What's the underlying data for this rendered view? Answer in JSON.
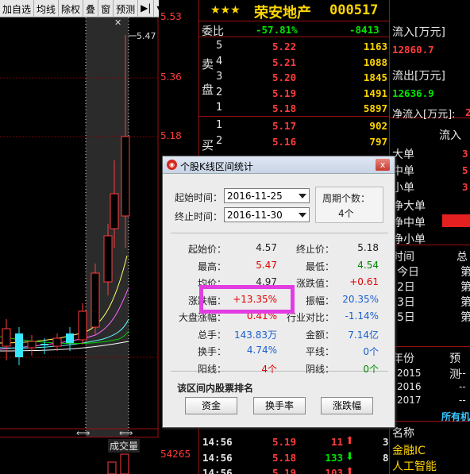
{
  "toolbar": {
    "items": [
      "加自选",
      "均线",
      "除权",
      "叠",
      "窗",
      "预测"
    ],
    "play_glyph": "▶|",
    "dropdown_glyph": "▾"
  },
  "chart": {
    "price_ticks": [
      "5.53",
      "5.36",
      "5.18"
    ],
    "high_marker": "5.47",
    "volume_label": "成交量",
    "volume_value": "54265",
    "nav_arrows": "⇐⇒"
  },
  "stock": {
    "stars": "★★★",
    "name": "荣安地产",
    "code": "000517"
  },
  "orderbook": {
    "weibi_label": "委比",
    "weibi_pct": "-57.81%",
    "weibi_diff": "-8413",
    "sell_label": [
      "卖",
      "盘"
    ],
    "buy_label": [
      "买"
    ],
    "sells": [
      {
        "level": "5",
        "price": "5.22",
        "vol": "1163"
      },
      {
        "level": "4",
        "price": "5.21",
        "vol": "1088"
      },
      {
        "level": "3",
        "price": "5.20",
        "vol": "1845"
      },
      {
        "level": "2",
        "price": "5.19",
        "vol": "1491"
      },
      {
        "level": "1",
        "price": "5.18",
        "vol": "5897"
      }
    ],
    "buys": [
      {
        "level": "1",
        "price": "5.17",
        "vol": "902"
      },
      {
        "level": "2",
        "price": "5.16",
        "vol": "797"
      }
    ]
  },
  "flow": {
    "inflow_label": "流入[万元]",
    "inflow_value": "12860.7",
    "outflow_label": "流出[万元]",
    "outflow_value": "12636.9",
    "net_label": "净流入[万元]:",
    "net_value": "2",
    "in_header": "流入",
    "rows": [
      {
        "label": "大单",
        "value": "3"
      },
      {
        "label": "中单",
        "value": "5"
      },
      {
        "label": "小单",
        "value": "3"
      }
    ],
    "net_rows": [
      "净大单",
      "净中单",
      "净小单"
    ]
  },
  "rank": {
    "headers": [
      "时间",
      "总"
    ],
    "rows": [
      {
        "label": "今日",
        "value": "第"
      },
      {
        "label": "2日",
        "value": "第"
      },
      {
        "label": "3日",
        "value": "第"
      },
      {
        "label": "5日",
        "value": "第"
      }
    ]
  },
  "forecast": {
    "headers": [
      "年份",
      "预测"
    ],
    "rows": [
      {
        "year": "2015",
        "value": "--"
      },
      {
        "year": "2016",
        "value": "--"
      },
      {
        "year": "2017",
        "value": "--"
      }
    ],
    "all_label": "所有机"
  },
  "concept": {
    "header": "名称",
    "items": [
      "金融IC",
      "人工智能"
    ]
  },
  "ticks": [
    {
      "time": "14:56",
      "price": "5.19",
      "vol": "11",
      "dir": "up",
      "n": "3"
    },
    {
      "time": "14:56",
      "price": "5.18",
      "vol": "133",
      "dir": "down",
      "n": "8"
    },
    {
      "time": "14:56",
      "price": "5.19",
      "vol": "103",
      "dir": "up",
      "n": ""
    }
  ],
  "dialog": {
    "title": "个股K线区间统计",
    "close_glyph": "x",
    "start_label": "起始时间：",
    "start_value": "2016-11-25",
    "end_label": "终止时间：",
    "end_value": "2016-11-30",
    "period_label": "周期个数：",
    "period_value": "4个",
    "stats": [
      {
        "l1": "起始价：",
        "v1": "4.57",
        "c1": "black",
        "l2": "终止价：",
        "v2": "5.18",
        "c2": "black"
      },
      {
        "l1": "最高：",
        "v1": "5.47",
        "c1": "red",
        "l2": "最低：",
        "v2": "4.54",
        "c2": "green"
      },
      {
        "l1": "均价：",
        "v1": "4.97",
        "c1": "black",
        "l2": "涨跌值：",
        "v2": "+0.61",
        "c2": "red"
      },
      {
        "l1": "涨跌幅：",
        "v1": "+13.35%",
        "c1": "red",
        "l2": "振幅：",
        "v2": "20.35%",
        "c2": "blue"
      },
      {
        "l1": "大盘涨幅：",
        "v1": "0.41%",
        "c1": "red",
        "l2": "行业对比：",
        "v2": "-1.14%",
        "c2": "blue"
      },
      {
        "l1": "总手：",
        "v1": "143.83万",
        "c1": "blue",
        "l2": "金额：",
        "v2": "7.14亿",
        "c2": "blue"
      },
      {
        "l1": "换手：",
        "v1": "4.74%",
        "c1": "blue",
        "l2": "平线：",
        "v2": "0个",
        "c2": "blue"
      },
      {
        "l1": "阳线：",
        "v1": "4个",
        "c1": "red",
        "l2": "阴线：",
        "v2": "0个",
        "c2": "green"
      }
    ],
    "rank_title": "该区间内股票排名",
    "buttons": [
      "资金",
      "换手率",
      "涨跌幅"
    ]
  },
  "colors": {
    "up": "#ff3c3c",
    "down": "#00e600",
    "highlight": "#e23de2",
    "grid": "#9a1010"
  }
}
